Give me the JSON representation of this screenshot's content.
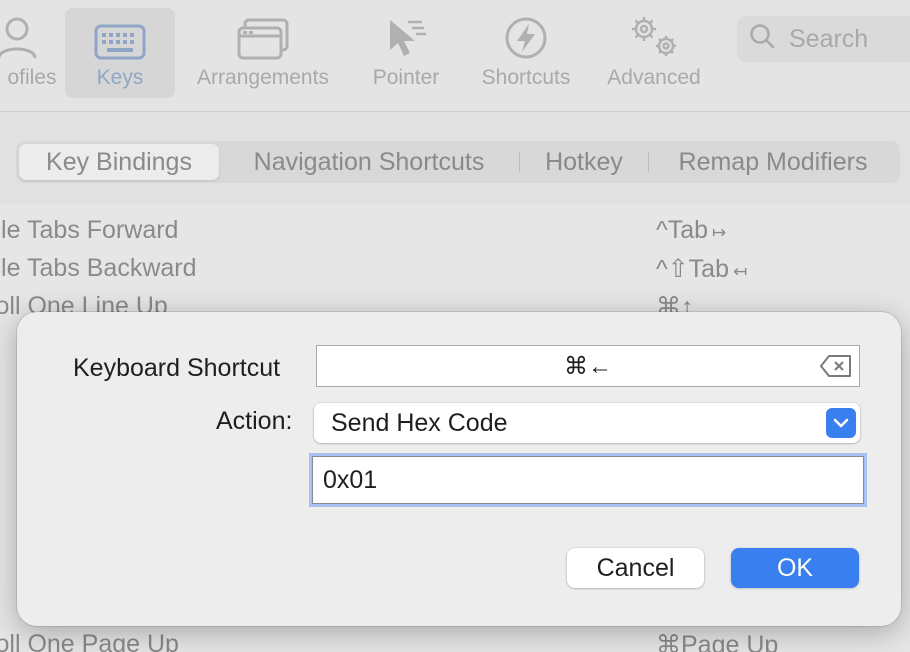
{
  "toolbar": {
    "items": [
      {
        "label": "Profiles",
        "shown_label": "ofiles",
        "icon": "person-icon"
      },
      {
        "label": "Keys",
        "icon": "keyboard-icon",
        "selected": true
      },
      {
        "label": "Arrangements",
        "icon": "windows-icon"
      },
      {
        "label": "Pointer",
        "icon": "pointer-icon"
      },
      {
        "label": "Shortcuts",
        "icon": "bolt-icon"
      },
      {
        "label": "Advanced",
        "icon": "gears-icon"
      }
    ],
    "search_placeholder": "Search"
  },
  "tabs": [
    {
      "label": "Key Bindings",
      "active": true
    },
    {
      "label": "Navigation Shortcuts"
    },
    {
      "label": "Hotkey"
    },
    {
      "label": "Remap Modifiers"
    }
  ],
  "bindings": [
    {
      "action": "Cycle Tabs Forward",
      "keys": "^Tab",
      "tail": "↦"
    },
    {
      "action": "Cycle Tabs Backward",
      "keys": "^⇧Tab",
      "tail": "↤"
    },
    {
      "action": "Scroll One Line Up",
      "keys": "⌘↑",
      "tail": ""
    },
    {
      "action": "Scroll One Page Up",
      "keys": "⌘Page Up",
      "tail": ""
    }
  ],
  "dialog": {
    "shortcut_label": "Keyboard Shortcut",
    "shortcut_value": "⌘←",
    "action_label": "Action:",
    "action_value": "Send Hex Code",
    "hex_value": "0x01",
    "cancel_label": "Cancel",
    "ok_label": "OK"
  },
  "colors": {
    "accent": "#3a7ff0",
    "focus_ring": "#a8c2f3",
    "sheet_bg": "#ededed"
  }
}
